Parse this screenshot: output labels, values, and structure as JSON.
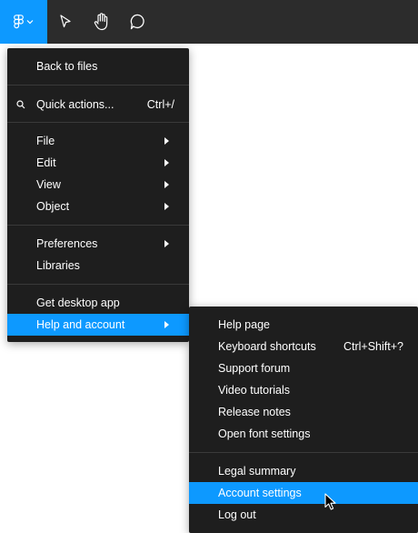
{
  "toolbar": {
    "tools": [
      {
        "icon": "figma-logo-icon",
        "active": true
      },
      {
        "icon": "move-cursor-icon"
      },
      {
        "icon": "hand-icon"
      },
      {
        "icon": "comment-icon"
      }
    ],
    "accent_color": "#0d99ff",
    "background_color": "#2c2c2c"
  },
  "main_menu": {
    "back": "Back to files",
    "quick_actions": {
      "label": "Quick actions...",
      "shortcut": "Ctrl+/",
      "icon": "search-icon"
    },
    "file": "File",
    "edit": "Edit",
    "view": "View",
    "object": "Object",
    "preferences": "Preferences",
    "libraries": "Libraries",
    "desktop_app": "Get desktop app",
    "help_account": "Help and account"
  },
  "help_menu": {
    "help_page": "Help page",
    "keyboard_shortcuts": {
      "label": "Keyboard shortcuts",
      "shortcut": "Ctrl+Shift+?"
    },
    "support_forum": "Support forum",
    "video_tutorials": "Video tutorials",
    "release_notes": "Release notes",
    "font_settings": "Open font settings",
    "legal_summary": "Legal summary",
    "account_settings": "Account settings",
    "log_out": "Log out"
  }
}
